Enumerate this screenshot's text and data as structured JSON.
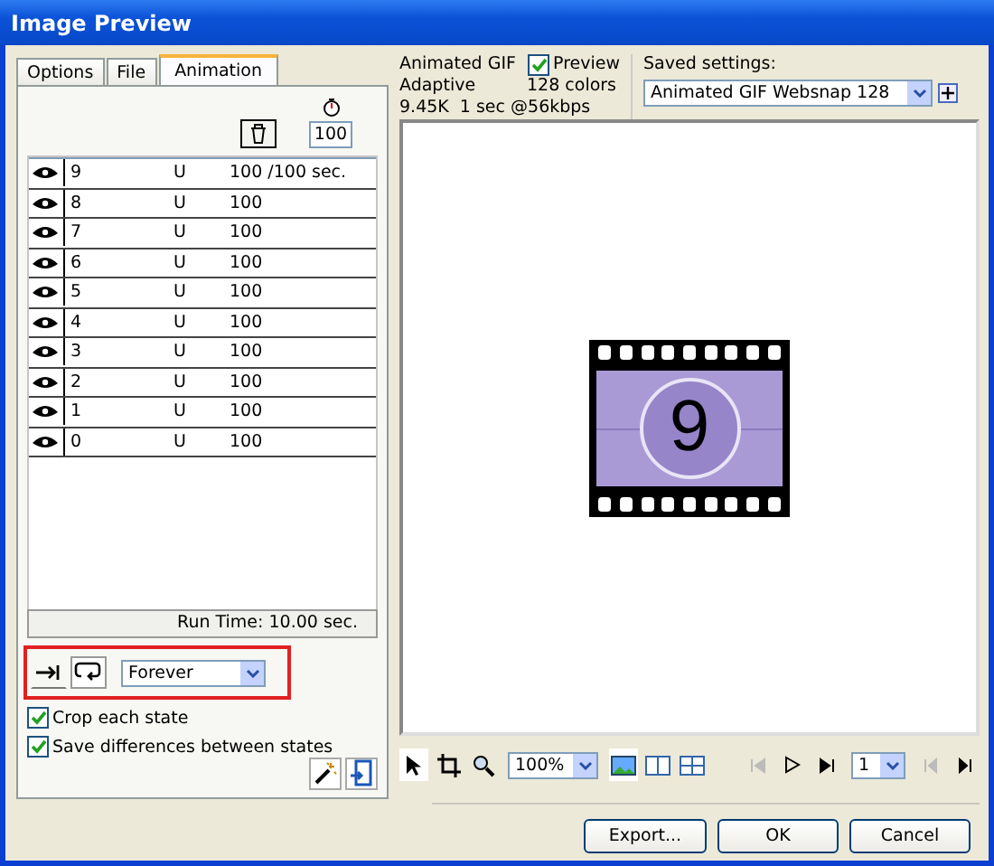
{
  "window": {
    "title": "Image Preview"
  },
  "tabs": [
    {
      "label": "Options",
      "selected": false
    },
    {
      "label": "File",
      "selected": false
    },
    {
      "label": "Animation",
      "selected": true
    }
  ],
  "frame_delay": "100",
  "frames": [
    {
      "name": "9",
      "disposal": "U",
      "delay": "100 /100 sec.",
      "selected": true
    },
    {
      "name": "8",
      "disposal": "U",
      "delay": "100",
      "selected": false
    },
    {
      "name": "7",
      "disposal": "U",
      "delay": "100",
      "selected": false
    },
    {
      "name": "6",
      "disposal": "U",
      "delay": "100",
      "selected": false
    },
    {
      "name": "5",
      "disposal": "U",
      "delay": "100",
      "selected": false
    },
    {
      "name": "4",
      "disposal": "U",
      "delay": "100",
      "selected": false
    },
    {
      "name": "3",
      "disposal": "U",
      "delay": "100",
      "selected": false
    },
    {
      "name": "2",
      "disposal": "U",
      "delay": "100",
      "selected": false
    },
    {
      "name": "1",
      "disposal": "U",
      "delay": "100",
      "selected": false
    },
    {
      "name": "0",
      "disposal": "U",
      "delay": "100",
      "selected": false
    }
  ],
  "run_time": "Run Time: 10.00 sec.",
  "loop": {
    "play_once_selected": false,
    "loop_selected": true,
    "repeat": "Forever"
  },
  "options": [
    {
      "label": "Crop each state",
      "checked": true
    },
    {
      "label": "Save differences between states",
      "checked": true
    }
  ],
  "info": {
    "format": "Animated GIF",
    "palette": "Adaptive",
    "size": "9.45K  1 sec @56kbps",
    "colors": "128 colors",
    "preview": {
      "label": "Preview",
      "checked": true
    }
  },
  "saved_settings": {
    "label": "Saved settings:",
    "value": "Animated GIF Websnap 128"
  },
  "preview_frame": "9",
  "toolbar": {
    "zoom": "100%",
    "frame": "1"
  },
  "buttons": [
    "Export...",
    "OK",
    "Cancel"
  ]
}
